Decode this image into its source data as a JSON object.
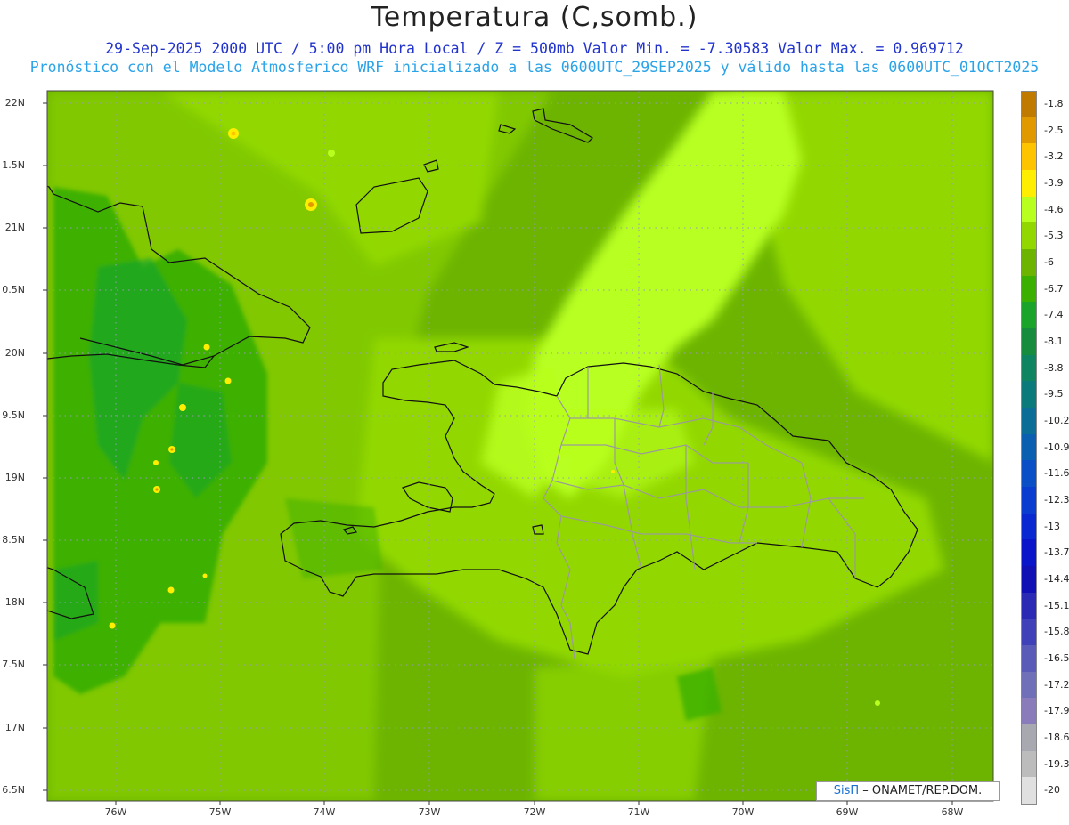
{
  "header": {
    "title": "Temperatura (C,somb.)",
    "subtitle1": "29-Sep-2025  2000 UTC / 5:00 pm Hora Local / Z = 500mb  Valor Min. = -7.30583  Valor Max. = 0.969712",
    "subtitle2": "Pronóstico con el Modelo Atmosferico WRF inicializado a las 0600UTC_29SEP2025 y válido hasta las  0600UTC_01OCT2025"
  },
  "chart_data": {
    "type": "heatmap",
    "x_ticks": [
      "76W",
      "75W",
      "74W",
      "73W",
      "72W",
      "71W",
      "70W",
      "69W",
      "68W"
    ],
    "y_ticks": [
      "22N",
      "1.5N",
      "21N",
      "0.5N",
      "20N",
      "9.5N",
      "19N",
      "8.5N",
      "18N",
      "7.5N",
      "17N",
      "6.5N"
    ],
    "xlim": [
      -76.65,
      -67.6
    ],
    "ylim": [
      16.43,
      22.1
    ],
    "colorbar": {
      "labels": [
        "-1.8",
        "-2.5",
        "-3.2",
        "-3.9",
        "-4.6",
        "-5.3",
        "-6",
        "-6.7",
        "-7.4",
        "-8.1",
        "-8.8",
        "-9.5",
        "-10.2",
        "-10.9",
        "-11.6",
        "-12.3",
        "-13",
        "-13.7",
        "-14.4",
        "-15.1",
        "-15.8",
        "-16.5",
        "-17.2",
        "-17.9",
        "-18.6",
        "-19.3",
        "-20"
      ],
      "colors": [
        "#c07a00",
        "#e09a00",
        "#ffc400",
        "#ffee00",
        "#b8ff20",
        "#92d800",
        "#6cb400",
        "#3cb000",
        "#1aa52a",
        "#168c3c",
        "#0f8460",
        "#0a7a7a",
        "#0a6e96",
        "#0a5fb0",
        "#0a4fc6",
        "#0a3cd0",
        "#0a28d2",
        "#0a14c8",
        "#1010b4",
        "#2a2ab4",
        "#4040b8",
        "#5a5ab8",
        "#7070b8",
        "#8a7cba",
        "#a8a8b0",
        "#bcbcbc",
        "#e0e0e0"
      ]
    },
    "field_colors": {
      "dominant": "#6cb400",
      "warm_band": "#b8ff20",
      "mid": "#92d800",
      "cold_spots": "#3cb000",
      "hot_spots": "#ffee00"
    }
  },
  "credit": {
    "brand": "SisΠ",
    "text": "– ONAMET/REP.DOM."
  }
}
